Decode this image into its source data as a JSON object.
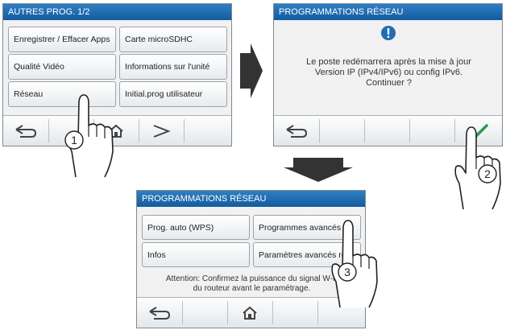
{
  "screen1": {
    "title": "AUTRES PROG.  1/2",
    "buttons": [
      "Enregistrer / Effacer Apps",
      "Carte microSDHC",
      "Qualité Vidéo",
      "Informations sur l'unité",
      "Réseau",
      "Initial.prog utilisateur"
    ],
    "bottom_icons": [
      "back-arrow-icon",
      "home-icon",
      "next-chevron-icon"
    ],
    "step": "1"
  },
  "screen2": {
    "title": "PROGRAMMATIONS RÉSEAU",
    "alert_icon": "exclamation-icon",
    "message": [
      "Le poste redémarrera après la mise à jour",
      "Version IP (IPv4/IPv6) ou config IPv6.",
      "Continuer ?"
    ],
    "bottom_icons": [
      "back-arrow-icon",
      "checkmark-icon"
    ],
    "step": "2"
  },
  "screen3": {
    "title": "PROGRAMMATIONS RÉSEAU",
    "buttons": [
      "Prog. auto (WPS)",
      "Programmes avancés",
      "Infos",
      "Paramètres avancés ré"
    ],
    "message": [
      "Attention: Confirmez la puissance du signal W-F",
      "du routeur avant le paramétrage."
    ],
    "bottom_icons": [
      "back-arrow-icon",
      "home-icon"
    ],
    "step": "3"
  },
  "colors": {
    "title_bar": "#1f6eb4",
    "check_green": "#2f9a4a",
    "alert_blue": "#1f6eb4",
    "flow_arrow": "#333333"
  }
}
